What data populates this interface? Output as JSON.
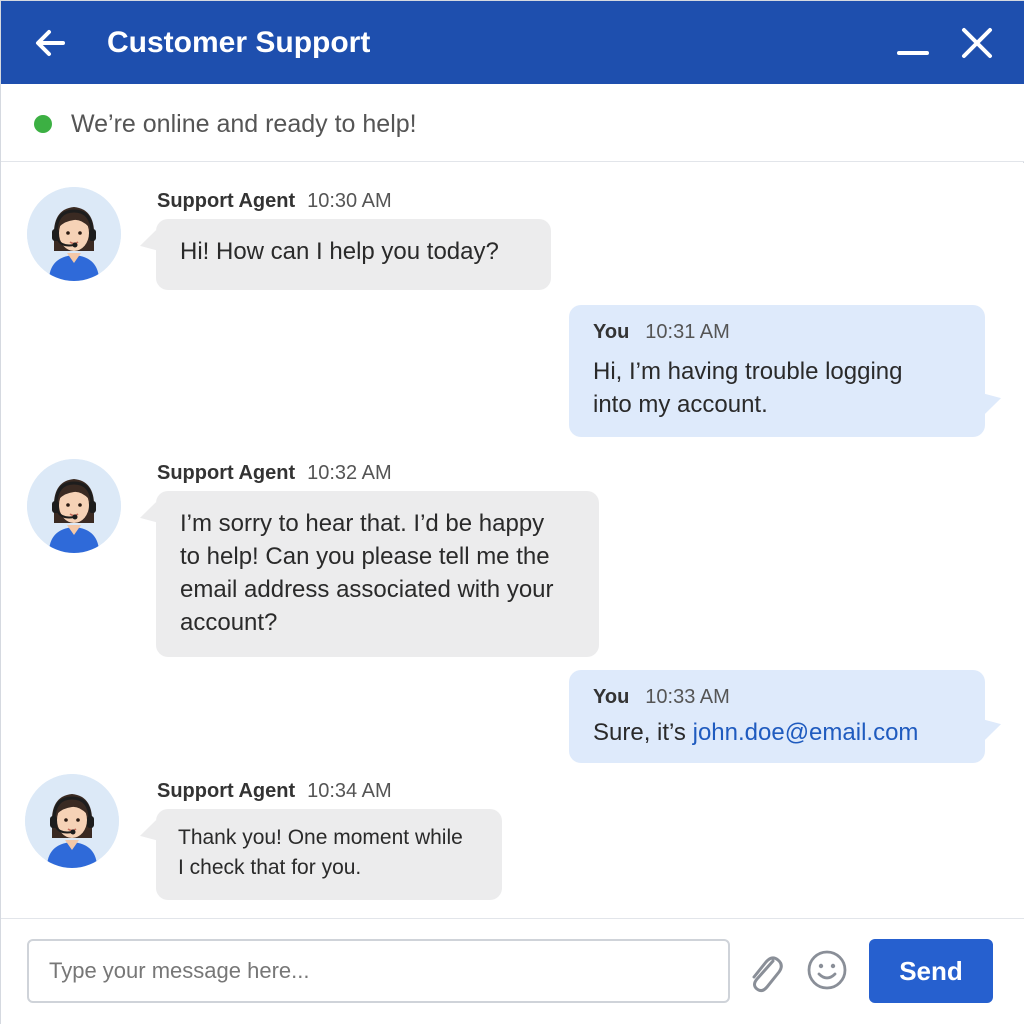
{
  "header": {
    "title": "Customer Support",
    "back_icon": "arrow-left-icon",
    "minimize_icon": "minimize-icon",
    "close_icon": "close-icon",
    "background_color": "#1e4fae"
  },
  "status": {
    "text": "We’re online and ready to help!",
    "indicator_color": "#3cb043"
  },
  "messages": [
    {
      "from": "agent",
      "sender": "Support Agent",
      "time": "10:30 AM",
      "lines": [
        "Hi! How can I help you today?"
      ]
    },
    {
      "from": "user",
      "sender": "You",
      "time": "10:31 AM",
      "lines": [
        "Hi, I’m having trouble logging",
        "into my account."
      ]
    },
    {
      "from": "agent",
      "sender": "Support Agent",
      "time": "10:32 AM",
      "lines": [
        "I’m sorry to hear that. I’d be happy",
        "to help! Can you please tell me the",
        "email address associated with your",
        "account?"
      ]
    },
    {
      "from": "user",
      "sender": "You",
      "time": "10:33 AM",
      "text_prefix": "Sure, it’s ",
      "link": "john.doe@email.com"
    },
    {
      "from": "agent",
      "sender": "Support Agent",
      "time": "10:34 AM",
      "lines": [
        "Thank you! One moment while",
        "I check that for you."
      ]
    }
  ],
  "composer": {
    "placeholder": "Type your message here...",
    "value": "",
    "attach_icon": "paperclip-icon",
    "emoji_icon": "smiley-icon",
    "send_label": "Send",
    "send_color": "#2660cf"
  },
  "colors": {
    "agent_bubble": "#ececed",
    "user_bubble": "#deeafb",
    "link": "#1f5bbf"
  }
}
